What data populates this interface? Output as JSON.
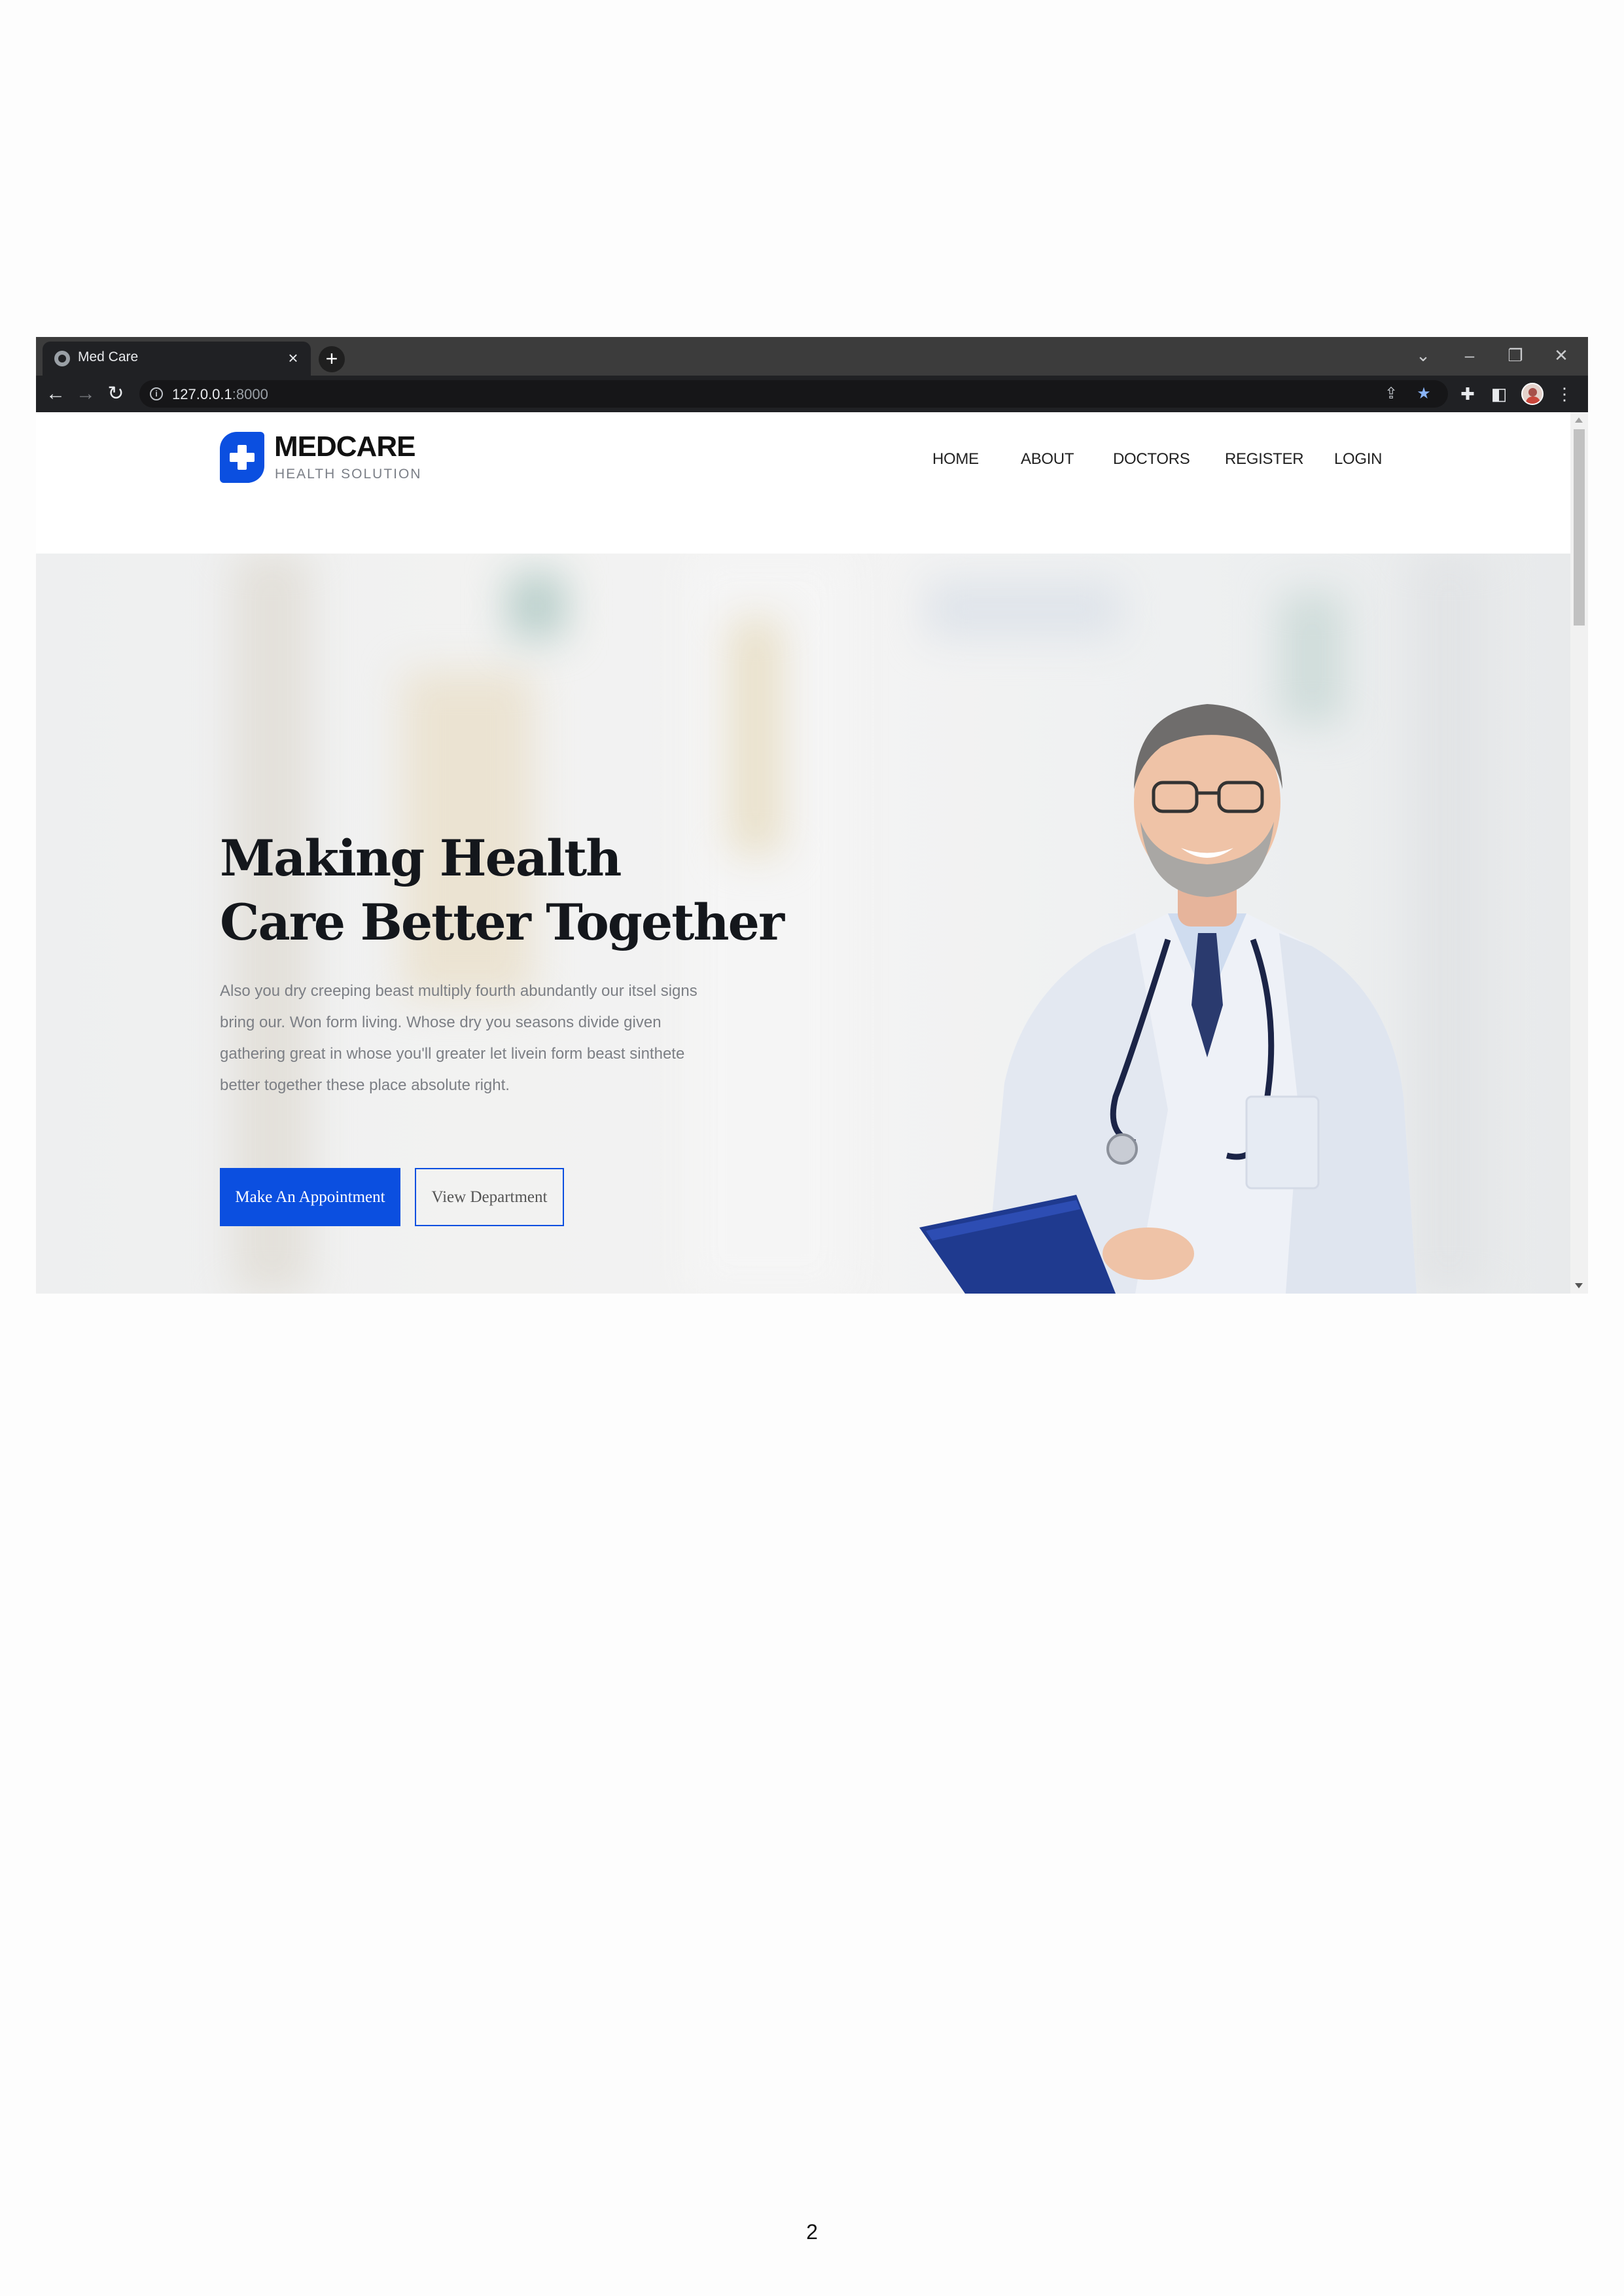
{
  "browser": {
    "tab_title": "Med Care",
    "url_host": "127.0.0.1",
    "url_port": ":8000",
    "icons": {
      "favicon": "globe-icon",
      "tab_close": "close-icon",
      "new_tab": "plus-icon",
      "back": "arrow-left-icon",
      "forward": "arrow-right-icon",
      "reload": "reload-icon",
      "site_info": "info-icon",
      "share": "share-icon",
      "bookmark": "star-icon",
      "extensions": "puzzle-icon",
      "side_panel": "side-panel-icon",
      "profile": "avatar-icon",
      "menu": "kebab-menu-icon"
    },
    "bookmark_color": "#8ab4f8"
  },
  "site": {
    "logo_name": "MEDCARE",
    "logo_tagline": "HEALTH SOLUTION",
    "brand_color": "#0b4fe0",
    "nav": [
      "HOME",
      "ABOUT",
      "DOCTORS",
      "REGISTER",
      "LOGIN"
    ]
  },
  "hero": {
    "title_line1": "Making Health",
    "title_line2": "Care Better Together",
    "text_lines": [
      "Also you dry creeping beast multiply fourth abundantly our itsel signs",
      "bring our. Won form living. Whose dry you seasons divide given",
      "gathering great in whose you'll greater let livein form beast sinthete",
      "better together these place absolute right."
    ],
    "primary_button": "Make An Appointment",
    "secondary_button": "View Department"
  },
  "page_number": "2"
}
